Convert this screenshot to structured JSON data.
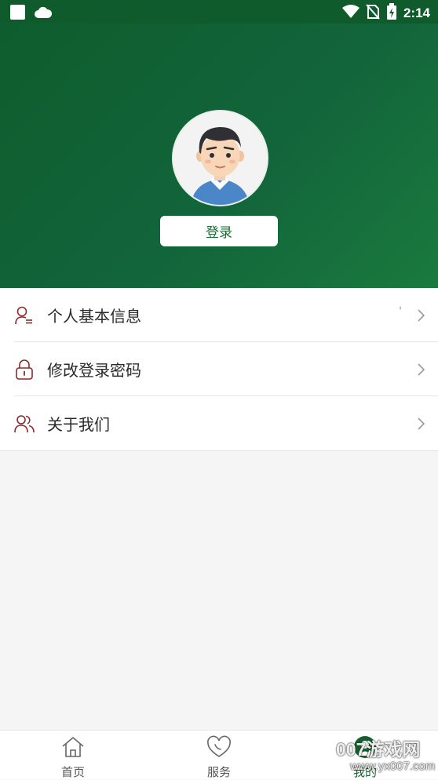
{
  "status_bar": {
    "time": "2:14",
    "icons_left": [
      "app-square-icon",
      "cloud-icon"
    ],
    "icons_right": [
      "wifi-icon",
      "no-sim-icon",
      "battery-charging-icon"
    ]
  },
  "header": {
    "login_label": "登录"
  },
  "menu": {
    "items": [
      {
        "label": "个人基本信息",
        "icon": "user-info-icon",
        "extra": "'"
      },
      {
        "label": "修改登录密码",
        "icon": "lock-icon"
      },
      {
        "label": "关于我们",
        "icon": "users-icon"
      }
    ]
  },
  "bottom_nav": {
    "tabs": [
      {
        "label": "首页",
        "icon": "home-icon"
      },
      {
        "label": "服务",
        "icon": "service-icon"
      },
      {
        "label": "我的",
        "icon": "profile-icon",
        "active": true
      }
    ]
  },
  "watermark": {
    "main": "007游戏网",
    "sub": "www.yx007.com"
  },
  "colors": {
    "header_green": "#0e5d2e",
    "accent_green": "#13602f",
    "icon_red": "#8b2a2a",
    "page_bg": "#f5f5f5"
  }
}
